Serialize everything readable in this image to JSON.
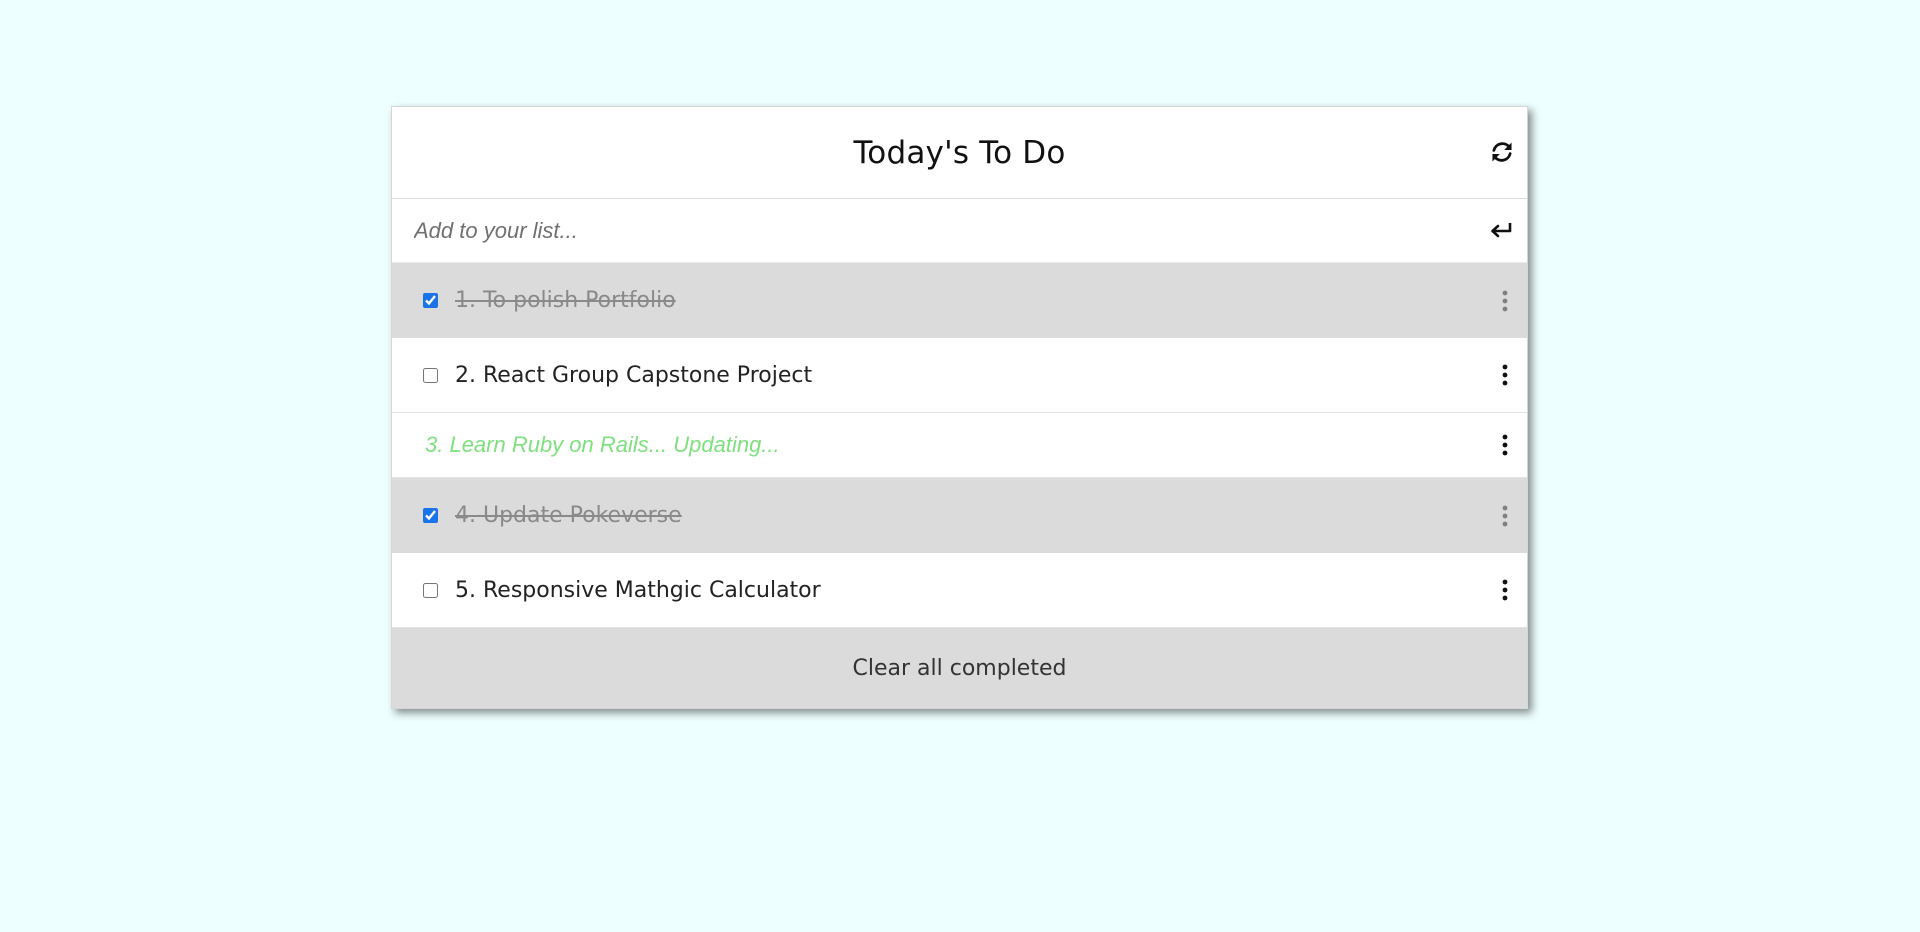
{
  "header": {
    "title": "Today's To Do",
    "refresh_icon": "refresh-icon"
  },
  "add": {
    "placeholder": "Add to your list...",
    "value": "",
    "enter_icon": "enter-icon"
  },
  "items": [
    {
      "label": "1. To polish Portfolio",
      "completed": true
    },
    {
      "label": "2. React Group Capstone Project",
      "completed": false
    },
    {
      "label": "3. Learn Ruby on Rails... Updating...",
      "editing": true
    },
    {
      "label": "4. Update Pokeverse",
      "completed": true
    },
    {
      "label": "5. Responsive Mathgic Calculator",
      "completed": false
    }
  ],
  "footer": {
    "clear_label": "Clear all completed"
  },
  "colors": {
    "background": "#eeffff",
    "completed_row": "#dbdbdb",
    "editing_text": "#7ee07e",
    "checkbox_accent": "#1a73e8"
  }
}
